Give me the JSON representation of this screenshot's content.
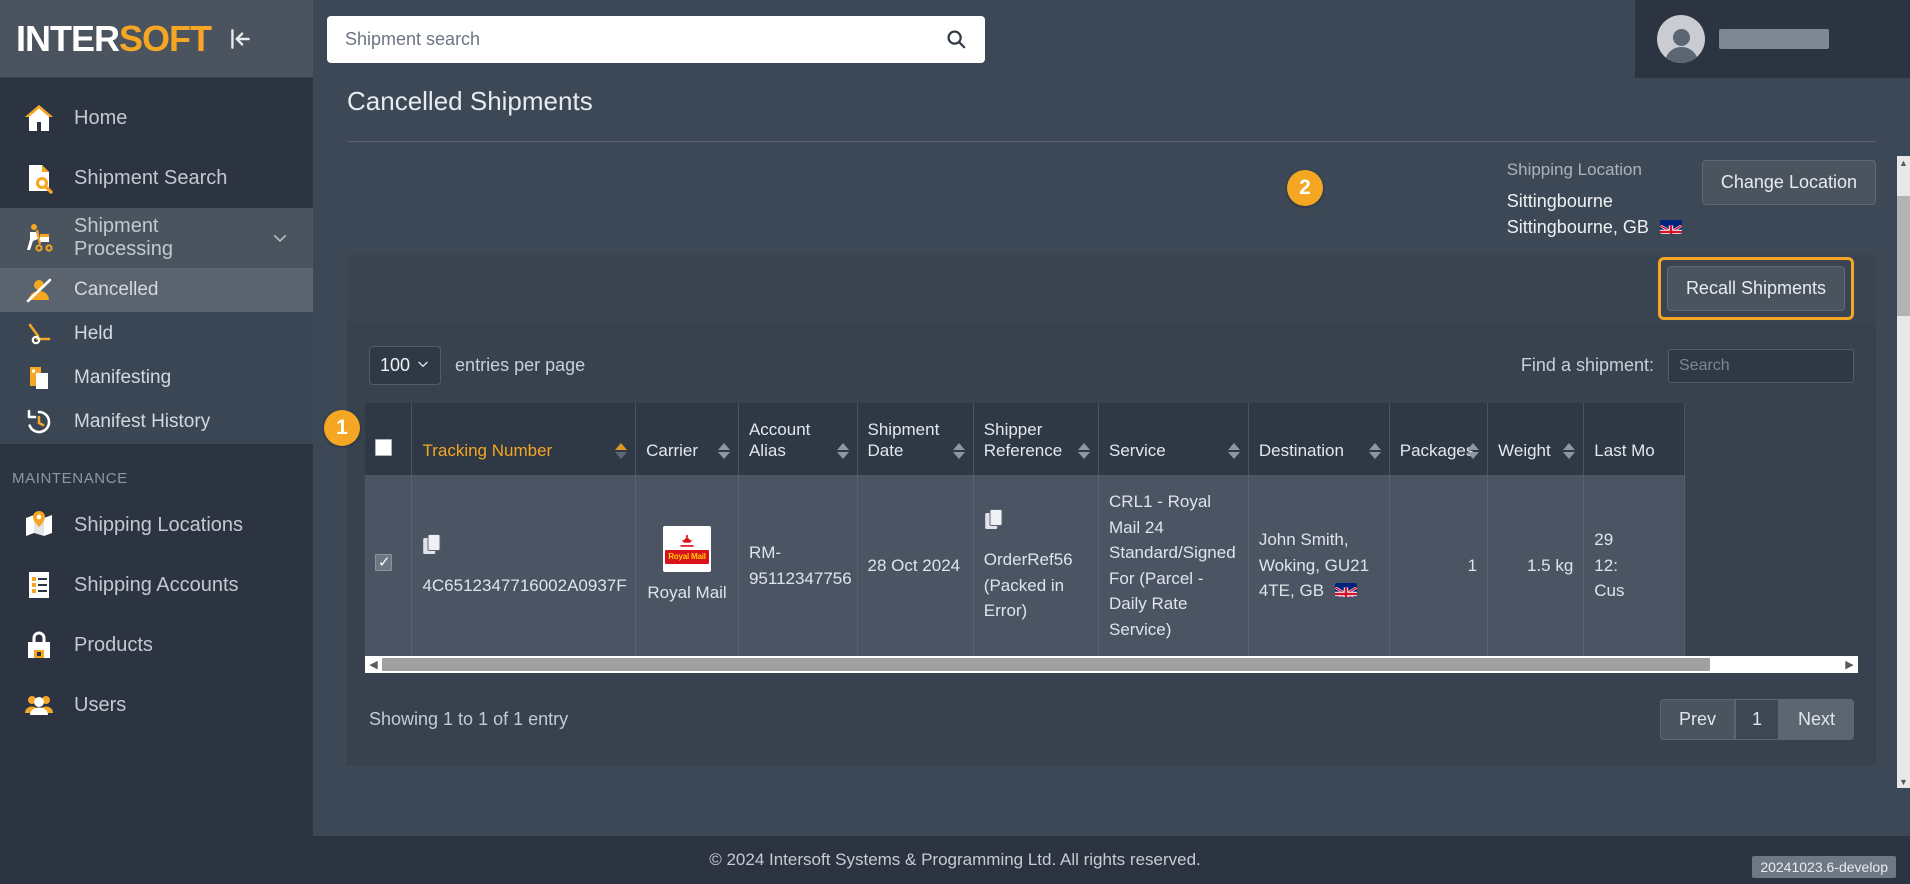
{
  "brand": {
    "name_white": "INTER",
    "name_orange": "SOFT",
    "collapse_icon": "collapse-left-icon"
  },
  "search": {
    "placeholder": "Shipment search",
    "value": "",
    "icon": "search-icon"
  },
  "user": {
    "avatar": "user-avatar-icon",
    "name_redacted": ""
  },
  "sidebar": {
    "items": [
      {
        "label": "Home",
        "icon": "home-icon"
      },
      {
        "label": "Shipment Search",
        "icon": "document-search-icon"
      },
      {
        "label": "Shipment Processing",
        "icon": "hand-truck-icon",
        "chevron": "chevron-down-icon"
      }
    ],
    "sub_items": [
      {
        "label": "Cancelled",
        "icon": "cancelled-person-icon",
        "active": true
      },
      {
        "label": "Held",
        "icon": "barrier-icon",
        "active": false
      },
      {
        "label": "Manifesting",
        "icon": "clipboard-icon",
        "active": false
      },
      {
        "label": "Manifest History",
        "icon": "history-clock-icon",
        "active": false
      }
    ],
    "section_label": "MAINTENANCE",
    "maintenance_items": [
      {
        "label": "Shipping Locations",
        "icon": "map-pin-icon"
      },
      {
        "label": "Shipping Accounts",
        "icon": "list-accounts-icon"
      },
      {
        "label": "Products",
        "icon": "lock-bag-icon"
      },
      {
        "label": "Users",
        "icon": "users-icon"
      }
    ]
  },
  "page": {
    "title": "Cancelled Shipments"
  },
  "location": {
    "label": "Shipping Location",
    "name": "Sittingbourne",
    "address": "Sittingbourne, GB",
    "flag": "gb-flag-icon",
    "change_button": "Change Location"
  },
  "toolbar": {
    "recall_button": "Recall Shipments"
  },
  "table_controls": {
    "entries_value": "100",
    "entries_caret": "chevron-down-icon",
    "entries_label": "entries per page",
    "find_label": "Find a shipment:",
    "find_placeholder": "Search",
    "find_value": ""
  },
  "table": {
    "columns": [
      {
        "label": "",
        "key": "select",
        "sortable": false
      },
      {
        "label": "Tracking Number",
        "key": "tracking",
        "sorted": "asc"
      },
      {
        "label": "Carrier",
        "key": "carrier"
      },
      {
        "label": "Account Alias",
        "key": "alias"
      },
      {
        "label": "Shipment Date",
        "key": "date"
      },
      {
        "label": "Shipper Reference",
        "key": "ref"
      },
      {
        "label": "Service",
        "key": "service"
      },
      {
        "label": "Destination",
        "key": "destination"
      },
      {
        "label": "Packages",
        "key": "packages"
      },
      {
        "label": "Weight",
        "key": "weight"
      },
      {
        "label": "Last Mo",
        "key": "lastmod"
      }
    ],
    "rows": [
      {
        "selected": true,
        "tracking": "4C6512347716002A0937F",
        "carrier": "Royal Mail",
        "carrier_logo_text": "Royal Mail",
        "alias": "RM-95112347756",
        "date": "28 Oct 2024",
        "ref": "OrderRef56 (Packed in Error)",
        "service": "CRL1 - Royal Mail 24 Standard/Signed For (Parcel - Daily Rate Service)",
        "destination": "John Smith, Woking, GU21 4TE, GB",
        "destination_flag": "gb-flag-icon",
        "packages": "1",
        "weight": "1.5 kg",
        "lastmod_line1": "29",
        "lastmod_line2": "12:",
        "lastmod_line3": "Cus"
      }
    ]
  },
  "pagination": {
    "showing": "Showing 1 to 1 of 1 entry",
    "prev": "Prev",
    "current_page": "1",
    "next": "Next"
  },
  "footer": {
    "copyright": "© 2024 Intersoft Systems & Programming Ltd. All rights reserved.",
    "version": "20241023.6-develop"
  },
  "annotations": [
    {
      "number": "1"
    },
    {
      "number": "2"
    }
  ]
}
